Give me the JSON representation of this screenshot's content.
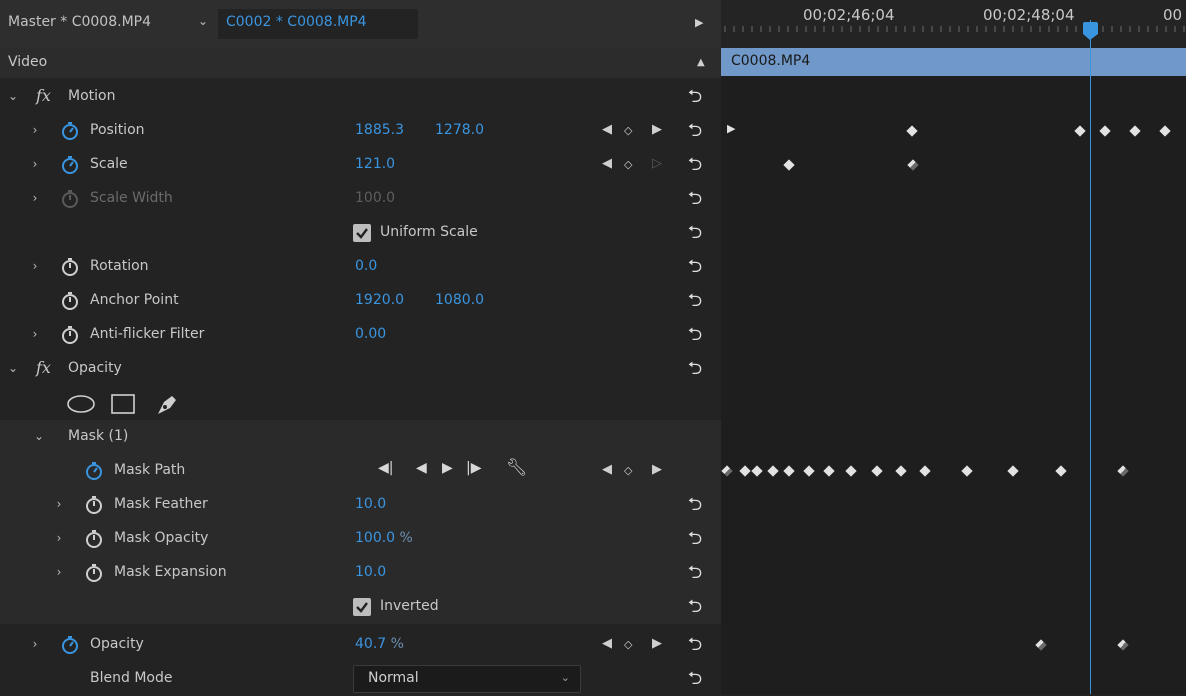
{
  "header": {
    "tab_master": "Master * C0008.MP4",
    "tab_sequence": "C0002 * C0008.MP4",
    "dropdown_icon": "chevron-down-icon",
    "play_icon": "play-triangle-icon"
  },
  "video_label": "Video",
  "effects": {
    "motion": {
      "name": "Motion",
      "position": {
        "label": "Position",
        "x": "1885.3",
        "y": "1278.0"
      },
      "scale": {
        "label": "Scale",
        "value": "121.0"
      },
      "scale_width": {
        "label": "Scale Width",
        "value": "100.0"
      },
      "uniform_scale": {
        "label": "Uniform Scale",
        "checked": true
      },
      "rotation": {
        "label": "Rotation",
        "value": "0.0"
      },
      "anchor_point": {
        "label": "Anchor Point",
        "x": "1920.0",
        "y": "1080.0"
      },
      "anti_flicker": {
        "label": "Anti-flicker Filter",
        "value": "0.00"
      }
    },
    "opacity": {
      "name": "Opacity",
      "mask": {
        "name": "Mask (1)",
        "path_label": "Mask Path",
        "feather": {
          "label": "Mask Feather",
          "value": "10.0"
        },
        "opacity": {
          "label": "Mask Opacity",
          "value": "100.0",
          "unit": "%"
        },
        "expansion": {
          "label": "Mask Expansion",
          "value": "10.0"
        },
        "inverted": {
          "label": "Inverted",
          "checked": true
        }
      },
      "opacity_prop": {
        "label": "Opacity",
        "value": "40.7",
        "unit": "%"
      },
      "blend_mode": {
        "label": "Blend Mode",
        "value": "Normal"
      }
    }
  },
  "timeline": {
    "timecodes": [
      "00;02;46;04",
      "00;02;48;04",
      "00"
    ],
    "clip_name": "C0008.MP4"
  },
  "colors": {
    "accent": "#3a95e0",
    "clip": "#7098c8",
    "panel_bg": "#232323"
  }
}
